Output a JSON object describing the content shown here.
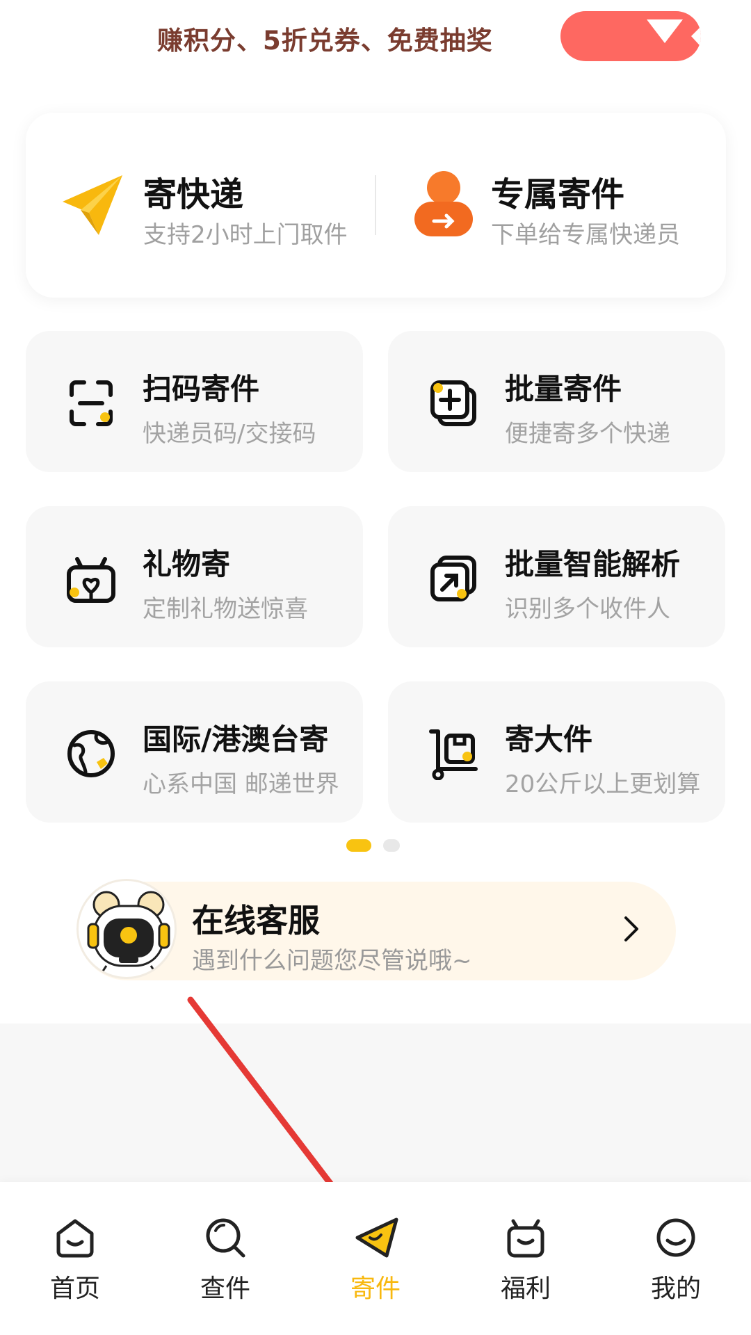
{
  "promo": {
    "text": "赚积分、5折兑券、免费抽奖"
  },
  "top_card": {
    "items": [
      {
        "title": "寄快递",
        "subtitle": "支持2小时上门取件",
        "icon": "paper-plane-icon"
      },
      {
        "title": "专属寄件",
        "subtitle": "下单给专属快递员",
        "icon": "courier-person-icon"
      }
    ]
  },
  "tiles": [
    {
      "title": "扫码寄件",
      "subtitle": "快递员码/交接码",
      "icon": "scan-icon"
    },
    {
      "title": "批量寄件",
      "subtitle": "便捷寄多个快递",
      "icon": "batch-add-icon"
    },
    {
      "title": "礼物寄",
      "subtitle": "定制礼物送惊喜",
      "icon": "gift-icon"
    },
    {
      "title": "批量智能解析",
      "subtitle": "识别多个收件人",
      "icon": "smart-parse-icon"
    },
    {
      "title": "国际/港澳台寄",
      "subtitle": "心系中国 邮递世界",
      "icon": "globe-icon"
    },
    {
      "title": "寄大件",
      "subtitle": "20公斤以上更划算",
      "icon": "cart-box-icon"
    }
  ],
  "pager": {
    "pages": 2,
    "current": 1
  },
  "service": {
    "title": "在线客服",
    "subtitle": "遇到什么问题您尽管说哦~",
    "icon": "robot-avatar"
  },
  "bottom_nav": {
    "items": [
      {
        "label": "首页",
        "icon": "home-icon",
        "active": false
      },
      {
        "label": "查件",
        "icon": "search-icon",
        "active": false
      },
      {
        "label": "寄件",
        "icon": "send-icon",
        "active": true
      },
      {
        "label": "福利",
        "icon": "gift-tv-icon",
        "active": false
      },
      {
        "label": "我的",
        "icon": "profile-smile-icon",
        "active": false
      }
    ]
  },
  "colors": {
    "accent_yellow": "#f8c311",
    "promo_red": "#fe6861",
    "annotation_arrow": "#e53935"
  }
}
